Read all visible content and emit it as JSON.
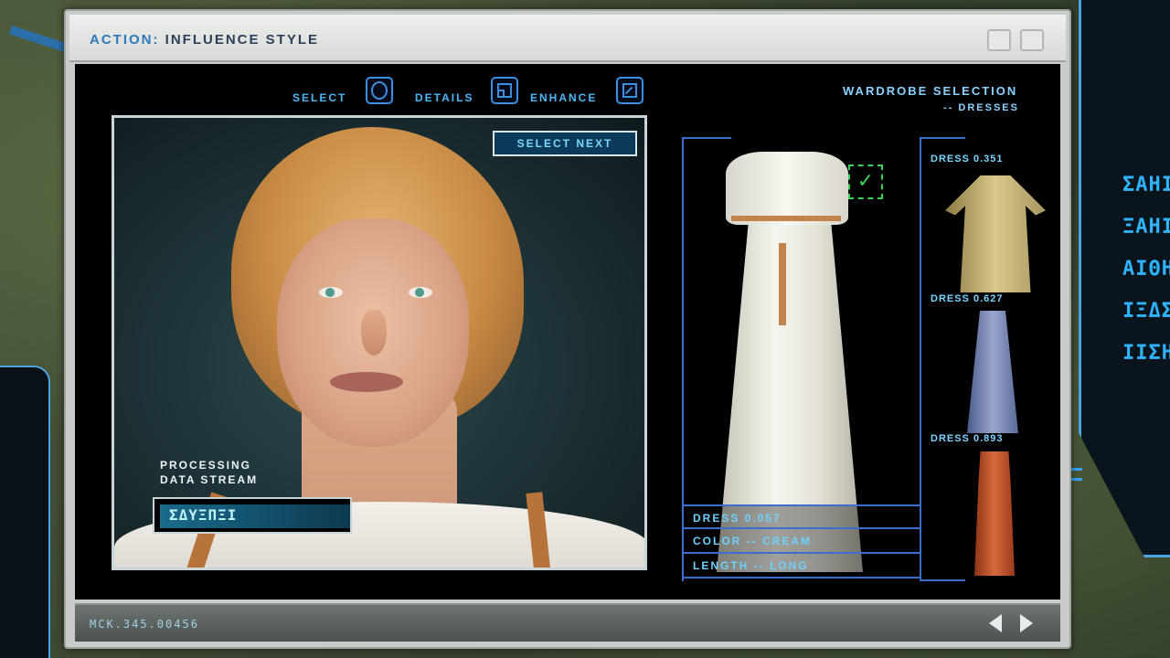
{
  "window": {
    "title_prefix": "ACTION:",
    "title_main": "INFLUENCE STYLE"
  },
  "toolbar": {
    "select_label": "SELECT",
    "details_label": "DETAILS",
    "enhance_label": "ENHANCE",
    "select_icon": "circle-icon",
    "details_icon": "grid-icon",
    "enhance_icon": "enhance-arrow-icon"
  },
  "wardrobe": {
    "title": "WARDROBE SELECTION",
    "subtitle": "-- DRESSES"
  },
  "viewport": {
    "select_next_label": "SELECT NEXT",
    "processing_line1": "PROCESSING",
    "processing_line2": "DATA STREAM",
    "data_stream_value": "ΣΔΥΞΠΞΙ"
  },
  "selected_dress": {
    "checked": true,
    "check_glyph": "✓",
    "info": [
      "DRESS 0.057",
      "COLOR -- CREAM",
      "LENGTH -- LONG"
    ],
    "color": "#f6f5ee"
  },
  "thumbnails": [
    {
      "label": "DRESS 0.351",
      "color": "#d8c88a"
    },
    {
      "label": "DRESS 0.627",
      "color": "#9aa6cc"
    },
    {
      "label": "DRESS 0.893",
      "color": "#d86a3c"
    }
  ],
  "status": {
    "code": "MCK.345.00456"
  },
  "side_glyphs": [
    "ΣΑΗΙ",
    "ΞΑΗΙ",
    "ΑΙΘΗ",
    "ΙΞΔΣ",
    "ΙΙΣΗ"
  ],
  "colors": {
    "accent": "#4ab8f8",
    "frame": "#3a6fd0",
    "check": "#3cd05a"
  }
}
